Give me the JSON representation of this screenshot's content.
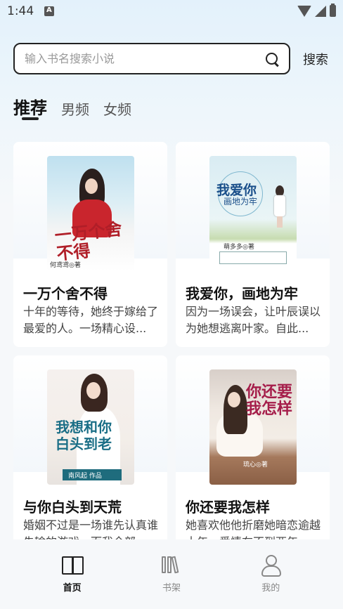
{
  "status_bar": {
    "time": "1:44"
  },
  "search": {
    "placeholder": "输入书名搜索小说",
    "button_label": "搜索"
  },
  "tabs": [
    {
      "label": "推荐",
      "active": true
    },
    {
      "label": "男频",
      "active": false
    },
    {
      "label": "女频",
      "active": false
    }
  ],
  "books": [
    {
      "title": "一万个舍不得",
      "description": "十年的等待，她终于嫁给了最爱的人。一场精心设...",
      "cover_title": "一万个舍不得",
      "cover_author": "何鸢鸢◎著"
    },
    {
      "title": "我爱你，画地为牢",
      "description": "因为一场误会，让叶辰误以为她想逃离叶家。自此...",
      "cover_title": "我爱你",
      "cover_subtitle": "画地为牢",
      "cover_author": "萌多多◎著"
    },
    {
      "title": "与你白头到天荒",
      "description": "婚姻不过是一场谁先认真谁先输的游戏，而我全部...",
      "cover_title": "我想和你白头到老",
      "cover_author": "南风起 作品"
    },
    {
      "title": "你还要我怎样",
      "description": "她喜欢他他折磨她暗恋逾越十年，爱情在不到两年...",
      "cover_title": "你还要我怎样",
      "cover_author": "琉心◎著"
    }
  ],
  "bottom_nav": [
    {
      "label": "首页",
      "icon": "book-open-icon",
      "active": true
    },
    {
      "label": "书架",
      "icon": "bookshelf-icon",
      "active": false
    },
    {
      "label": "我的",
      "icon": "user-icon",
      "active": false
    }
  ]
}
